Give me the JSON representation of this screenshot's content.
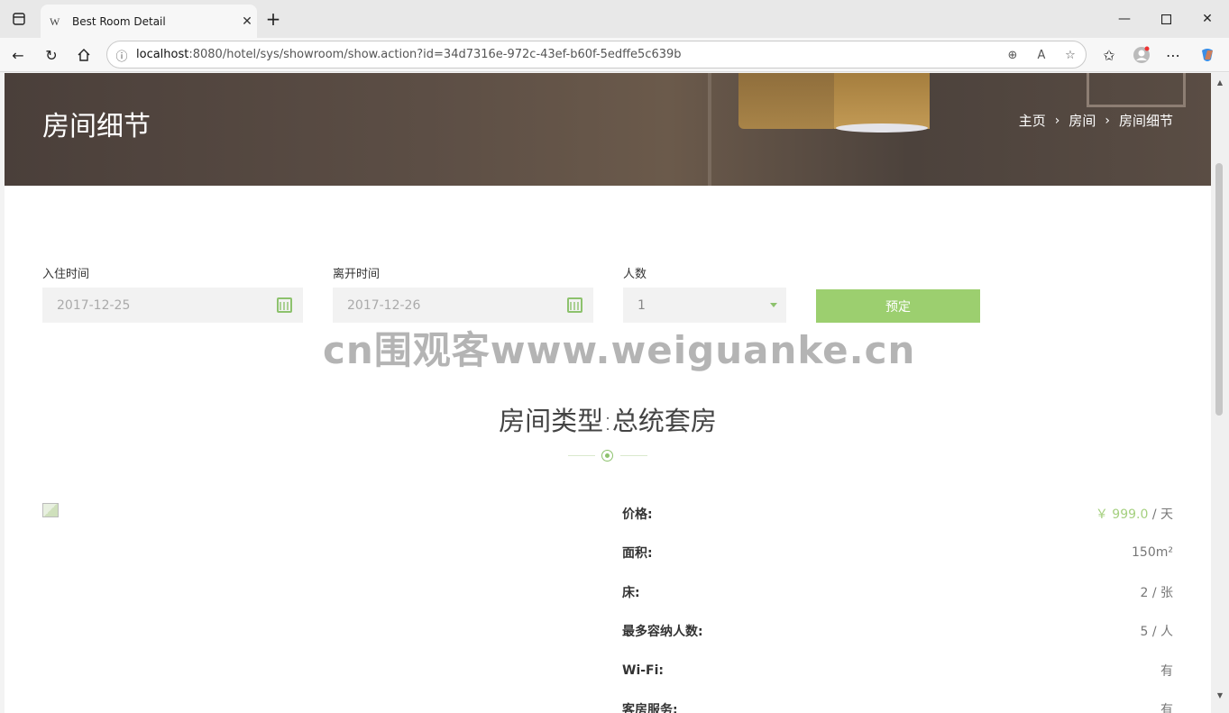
{
  "browser": {
    "tab_favicon": "W",
    "tab_title": "Best Room Detail",
    "url_host": "localhost",
    "url_rest": ":8080/hotel/sys/showroom/show.action?id=34d7316e-972c-43ef-b60f-5edffe5c639b"
  },
  "hero": {
    "title": "房间细节",
    "breadcrumb": [
      "主页",
      "房间",
      "房间细节"
    ]
  },
  "booking": {
    "checkin_label": "入住时间",
    "checkin_value": "2017-12-25",
    "checkout_label": "离开时间",
    "checkout_value": "2017-12-26",
    "guests_label": "人数",
    "guests_value": "1",
    "book_label": "预定"
  },
  "watermark": "cn围观客www.weiguanke.cn",
  "room": {
    "title": "房间类型:总统套房",
    "specs": [
      {
        "label": "价格:",
        "value": "￥ 999.0",
        "unit": " / 天"
      },
      {
        "label": "面积:",
        "value": "150m²",
        "unit": ""
      },
      {
        "label": "床:",
        "value": "2 / 张",
        "unit": ""
      },
      {
        "label": "最多容纳人数:",
        "value": "5 / 人",
        "unit": ""
      },
      {
        "label": "Wi-Fi:",
        "value": "有",
        "unit": ""
      },
      {
        "label": "客房服务:",
        "value": "有",
        "unit": ""
      }
    ]
  },
  "colors": {
    "accent": "#9ccf6f",
    "price": "#a5d07f"
  }
}
